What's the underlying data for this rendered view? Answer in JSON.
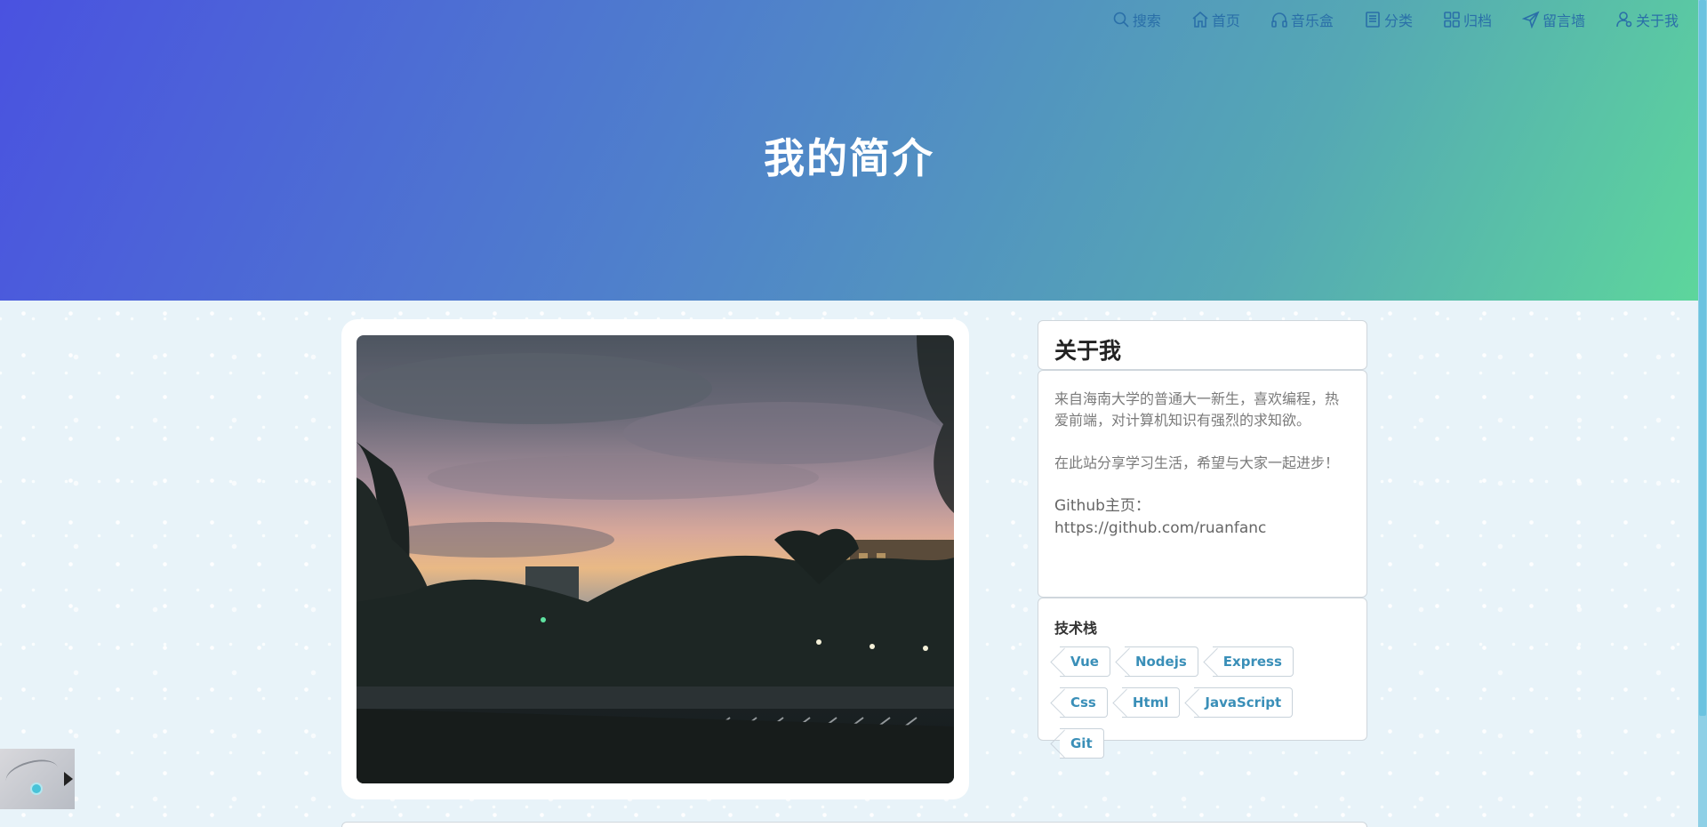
{
  "nav": {
    "items": [
      {
        "icon": "search-icon",
        "label": "搜索"
      },
      {
        "icon": "home-icon",
        "label": "首页"
      },
      {
        "icon": "headphones-icon",
        "label": "音乐盒"
      },
      {
        "icon": "book-icon",
        "label": "分类"
      },
      {
        "icon": "grid-icon",
        "label": "归档"
      },
      {
        "icon": "send-icon",
        "label": "留言墙"
      },
      {
        "icon": "user-icon",
        "label": "关于我"
      }
    ]
  },
  "hero": {
    "title": "我的简介"
  },
  "about": {
    "heading": "关于我",
    "para1": "来自海南大学的普通大一新生，喜欢编程，热爱前端，对计算机知识有强烈的求知欲。",
    "para2": "在此站分享学习生活，希望与大家一起进步！",
    "github_label": "Github主页：",
    "github_url": "https://github.com/ruanfanc"
  },
  "tech": {
    "heading": "技术栈",
    "tags": [
      "Vue",
      "Nodejs",
      "Express",
      "Css",
      "Html",
      "JavaScript",
      "Git"
    ]
  },
  "colors": {
    "hero_start": "#4a52e0",
    "hero_end": "#5dd69c",
    "nav_text": "#2a6fa8",
    "tag_text": "#3a8fb8"
  }
}
